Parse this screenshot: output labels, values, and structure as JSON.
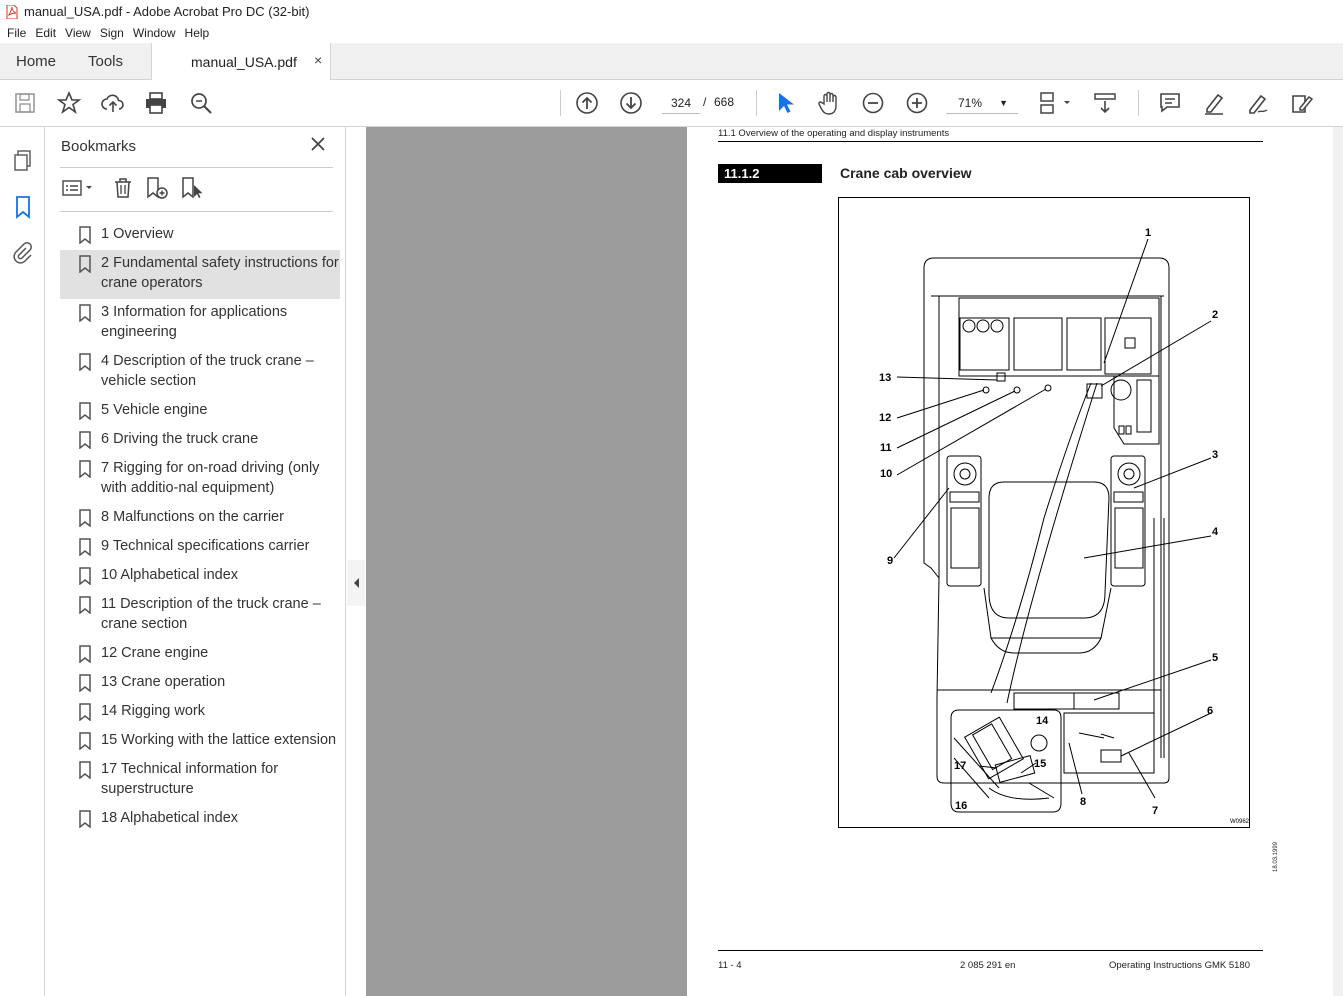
{
  "window": {
    "title": "manual_USA.pdf - Adobe Acrobat Pro DC (32-bit)"
  },
  "menu": [
    "File",
    "Edit",
    "View",
    "Sign",
    "Window",
    "Help"
  ],
  "tabs": {
    "home": "Home",
    "tools": "Tools",
    "document": "manual_USA.pdf",
    "close": "×"
  },
  "toolbar": {
    "page_current": "324",
    "page_sep": "/",
    "page_total": "668",
    "zoom": "71%",
    "icons": [
      "save-icon",
      "bookmark-star-icon",
      "upload-cloud-icon",
      "print-icon",
      "search-zoom-icon",
      "prev-page-icon",
      "next-page-icon",
      "select-cursor-icon",
      "hand-tool-icon",
      "zoom-out-icon",
      "zoom-in-icon",
      "page-layout-icon",
      "scroll-mode-icon",
      "comment-icon",
      "highlight-icon",
      "sign-icon",
      "edit-pdf-icon"
    ]
  },
  "accent": "#1473e6",
  "panel": {
    "title": "Bookmarks",
    "bookmarks": [
      {
        "label": "1 Overview"
      },
      {
        "label": "2 Fundamental safety instructions for crane operators",
        "selected": true
      },
      {
        "label": "3 Information for applications engineering"
      },
      {
        "label": "4 Description of the truck crane – vehicle section"
      },
      {
        "label": "5 Vehicle engine"
      },
      {
        "label": "6 Driving the truck crane"
      },
      {
        "label": "7 Rigging for on-road driving (only with additio-nal equipment)"
      },
      {
        "label": "8 Malfunctions on the carrier"
      },
      {
        "label": "9 Technical specifications carrier"
      },
      {
        "label": "10 Alphabetical index"
      },
      {
        "label": "11 Description of the truck crane – crane section"
      },
      {
        "label": "12 Crane engine"
      },
      {
        "label": "13 Crane operation"
      },
      {
        "label": "14 Rigging work"
      },
      {
        "label": "15 Working with the lattice extension"
      },
      {
        "label": "17 Technical information for superstructure"
      },
      {
        "label": "18 Alphabetical index"
      }
    ]
  },
  "page": {
    "header": "11.1 Overview of the operating and display instruments",
    "section_number": "11.1.2",
    "section_title": "Crane cab overview",
    "figure_id": "W0962",
    "callouts": [
      "1",
      "2",
      "3",
      "4",
      "5",
      "6",
      "7",
      "8",
      "9",
      "10",
      "11",
      "12",
      "13",
      "14",
      "15",
      "16",
      "17"
    ],
    "footer_left": "11 - 4",
    "footer_center": "2 085 291 en",
    "footer_right": "Operating Instructions GMK 5180",
    "side_date": "18.03.1999"
  }
}
